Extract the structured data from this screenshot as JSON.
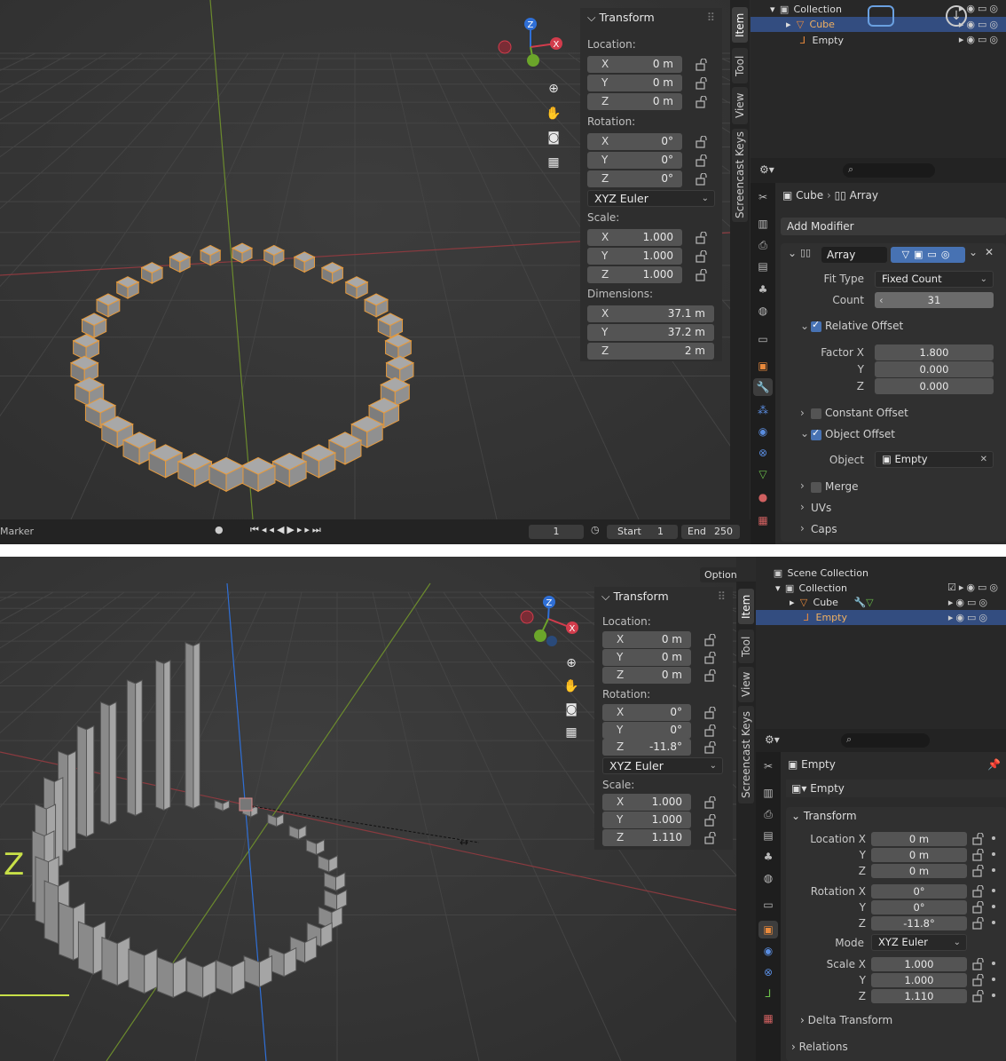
{
  "top": {
    "npanel": {
      "header": "Transform",
      "location_label": "Location:",
      "location": [
        {
          "axis": "X",
          "value": "0 m"
        },
        {
          "axis": "Y",
          "value": "0 m"
        },
        {
          "axis": "Z",
          "value": "0 m"
        }
      ],
      "rotation_label": "Rotation:",
      "rotation": [
        {
          "axis": "X",
          "value": "0°"
        },
        {
          "axis": "Y",
          "value": "0°"
        },
        {
          "axis": "Z",
          "value": "0°"
        }
      ],
      "rotation_mode": "XYZ Euler",
      "scale_label": "Scale:",
      "scale": [
        {
          "axis": "X",
          "value": "1.000"
        },
        {
          "axis": "Y",
          "value": "1.000"
        },
        {
          "axis": "Z",
          "value": "1.000"
        }
      ],
      "dimensions_label": "Dimensions:",
      "dimensions": [
        {
          "axis": "X",
          "value": "37.1 m"
        },
        {
          "axis": "Y",
          "value": "37.2 m"
        },
        {
          "axis": "Z",
          "value": "2 m"
        }
      ]
    },
    "tabs": [
      "Item",
      "Tool",
      "View",
      "Screencast Keys"
    ],
    "gizmo": {
      "z": "Z",
      "x": "X"
    },
    "outliner": {
      "rows": [
        {
          "name": "Collection"
        },
        {
          "name": "Cube"
        },
        {
          "name": "Empty"
        }
      ]
    },
    "breadcrumb": {
      "object": "Cube",
      "modifier": "Array"
    },
    "add_modifier": "Add Modifier",
    "modifier": {
      "name": "Array",
      "fit_type_label": "Fit Type",
      "fit_type": "Fixed Count",
      "count_label": "Count",
      "count": "31",
      "relative_offset": "Relative Offset",
      "factor_x_label": "Factor X",
      "factor_y_label": "Y",
      "factor_z_label": "Z",
      "factor_x": "1.800",
      "factor_y": "0.000",
      "factor_z": "0.000",
      "constant_offset": "Constant Offset",
      "object_offset": "Object Offset",
      "object_label": "Object",
      "object_value": "Empty",
      "merge": "Merge",
      "uvs": "UVs",
      "caps": "Caps"
    },
    "timeline": {
      "marker": "Marker",
      "frame": "1",
      "start_label": "Start",
      "start": "1",
      "end_label": "End",
      "end": "250"
    }
  },
  "bottom": {
    "options": "Options",
    "npanel": {
      "header": "Transform",
      "location_label": "Location:",
      "location": [
        {
          "axis": "X",
          "value": "0 m"
        },
        {
          "axis": "Y",
          "value": "0 m"
        },
        {
          "axis": "Z",
          "value": "0 m"
        }
      ],
      "rotation_label": "Rotation:",
      "rotation": [
        {
          "axis": "X",
          "value": "0°"
        },
        {
          "axis": "Y",
          "value": "0°"
        },
        {
          "axis": "Z",
          "value": "-11.8°"
        }
      ],
      "rotation_mode": "XYZ Euler",
      "scale_label": "Scale:",
      "scale": [
        {
          "axis": "X",
          "value": "1.000"
        },
        {
          "axis": "Y",
          "value": "1.000"
        },
        {
          "axis": "Z",
          "value": "1.110"
        }
      ]
    },
    "tabs": [
      "Item",
      "Tool",
      "View",
      "Screencast Keys"
    ],
    "z_overlay": "Z",
    "outliner": {
      "rows": [
        {
          "name": "Scene Collection"
        },
        {
          "name": "Collection"
        },
        {
          "name": "Cube"
        },
        {
          "name": "Empty"
        }
      ]
    },
    "props": {
      "object": "Empty",
      "data": "Empty",
      "section": "Transform",
      "loc_x_label": "Location X",
      "y_label": "Y",
      "z_label": "Z",
      "loc": [
        "0 m",
        "0 m",
        "0 m"
      ],
      "rot_x_label": "Rotation X",
      "rot": [
        "0°",
        "0°",
        "-11.8°"
      ],
      "mode_label": "Mode",
      "mode": "XYZ Euler",
      "scale_x_label": "Scale X",
      "scale": [
        "1.000",
        "1.000",
        "1.110"
      ],
      "delta": "Delta Transform",
      "relations": "Relations"
    }
  }
}
